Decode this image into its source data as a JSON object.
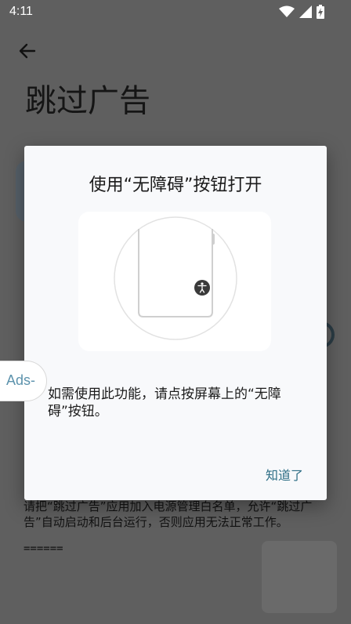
{
  "status_bar": {
    "time": "4:11",
    "icons": [
      "wifi-icon",
      "cell-signal-icon",
      "battery-charging-icon"
    ]
  },
  "app": {
    "back_icon": "arrow-left-icon",
    "title": "跳过广告",
    "notice_text": "请把“跳过广告”应用加入电源管理白名单，允许“跳过广告”自动启动和后台运行，否则应用无法正常工作。",
    "separator": "======"
  },
  "dialog": {
    "title": "使用“无障碍”按钮打开",
    "illustration": "accessibility-button-illustration",
    "body": "如需使用此功能，请点按屏幕上的“无障碍”按钮。",
    "ok_label": "知道了"
  },
  "floating_badge": {
    "label": "Ads-"
  },
  "colors": {
    "accent": "#2f6f86",
    "scrim_background": "#5f5f5f",
    "dialog_background": "#f8f9fb"
  }
}
